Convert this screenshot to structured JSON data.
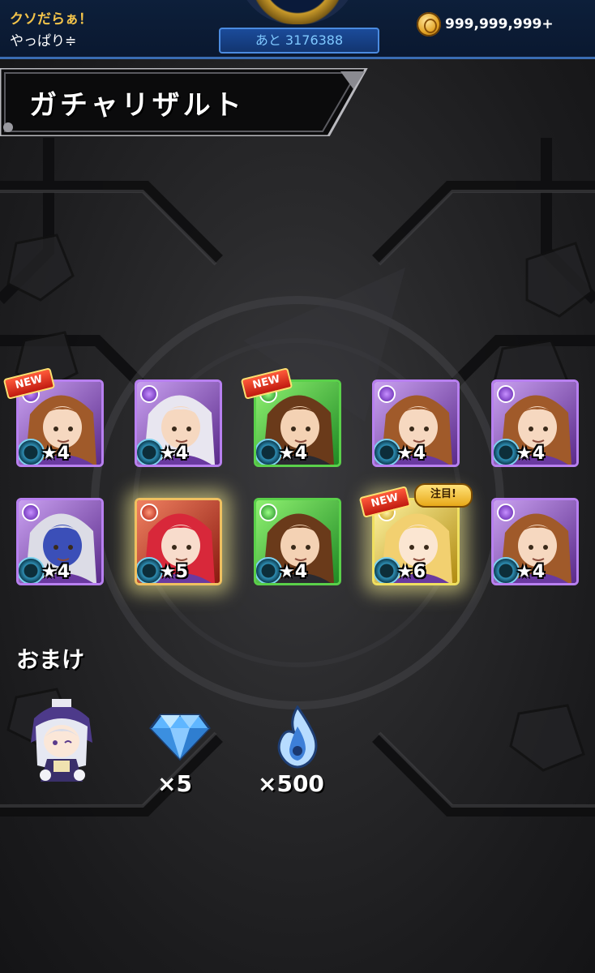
{
  "header": {
    "player_name": "クソだらぁ！",
    "player_sub": "やっぱり≑",
    "remaining_label": "あと 3176388",
    "coin_amount": "999,999,999+"
  },
  "screen_title": "ガチャリザルト",
  "results": [
    {
      "rarity": "★4",
      "element": "dark",
      "new": true
    },
    {
      "rarity": "★4",
      "element": "dark",
      "new": false
    },
    {
      "rarity": "★4",
      "element": "wood",
      "new": true
    },
    {
      "rarity": "★4",
      "element": "dark",
      "new": false
    },
    {
      "rarity": "★4",
      "element": "dark",
      "new": false
    },
    {
      "rarity": "★4",
      "element": "dark",
      "new": false
    },
    {
      "rarity": "★5",
      "element": "fire",
      "new": false
    },
    {
      "rarity": "★4",
      "element": "wood",
      "new": false
    },
    {
      "rarity": "★6",
      "element": "light",
      "new": true,
      "focus": true
    },
    {
      "rarity": "★4",
      "element": "dark",
      "new": false
    }
  ],
  "badges": {
    "new": "NEW",
    "focus": "注目!"
  },
  "bonus": {
    "title": "おまけ",
    "gem_count": "×5",
    "essence_count": "×500"
  },
  "colors": {
    "topbar": "#0a1830",
    "accent_gold": "#f3c44a",
    "accent_blue": "#3a6cb3",
    "dark_element": "#7a3ad0",
    "wood_element": "#2fb830",
    "light_element": "#f2d030"
  }
}
